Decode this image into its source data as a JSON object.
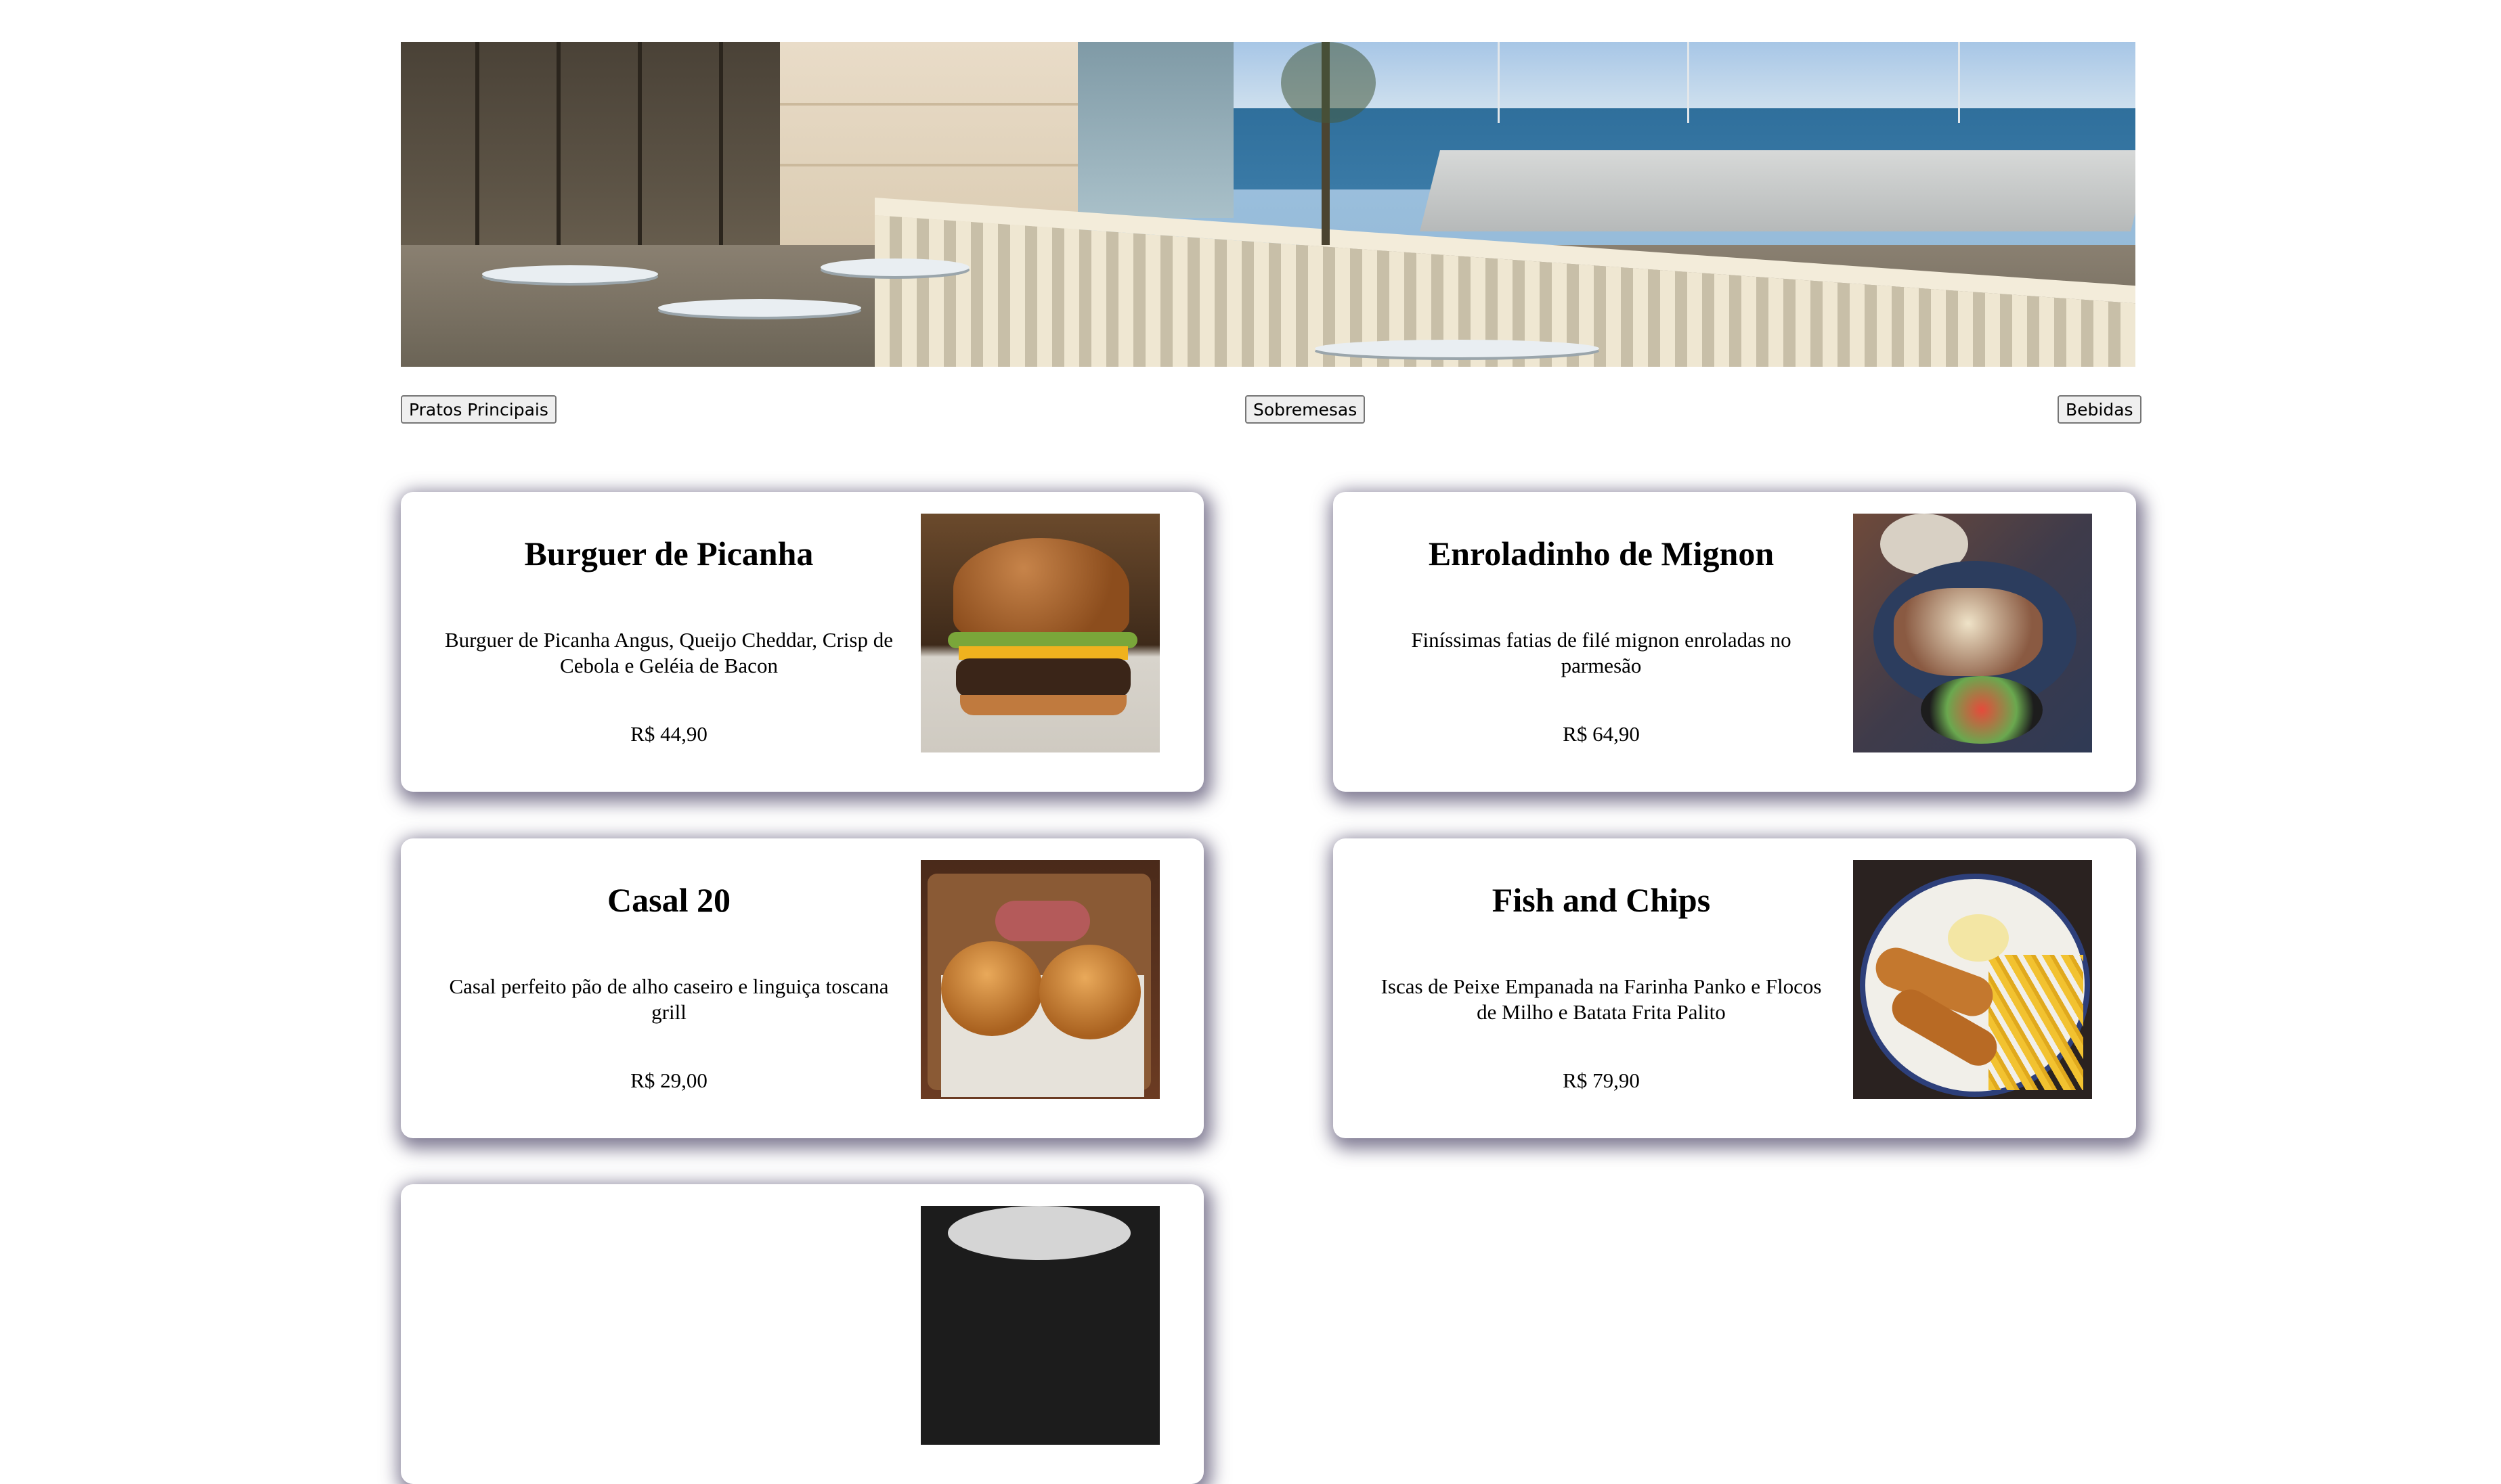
{
  "hero": {
    "image_alt": "Restaurant terrace overlooking the marina"
  },
  "tabs": [
    {
      "label": "Pratos Principais"
    },
    {
      "label": "Sobremesas"
    },
    {
      "label": "Bebidas"
    }
  ],
  "menu": [
    {
      "title": "Burguer de Picanha",
      "description": "Burguer de Picanha Angus, Queijo Cheddar, Crisp de Cebola e Geléia de Bacon",
      "price": "R$ 44,90",
      "photo": "burger-photo"
    },
    {
      "title": "Enroladinho de Mignon",
      "description": "Finíssimas fatias de filé mignon enroladas no parmesão",
      "price": "R$ 64,90",
      "photo": "mignon-photo"
    },
    {
      "title": "Casal 20",
      "description": "Casal perfeito pão de alho caseiro e linguiça toscana grill",
      "price": "R$ 29,00",
      "photo": "garlic-bread-photo"
    },
    {
      "title": "Fish and Chips",
      "description": "Iscas de Peixe Empanada na Farinha Panko e Flocos de Milho e Batata Frita Palito",
      "price": "R$ 79,90",
      "photo": "fish-and-chips-photo"
    }
  ],
  "colors": {
    "card_shadow": "#342c52",
    "button_bg": "#efefef",
    "button_border": "#767676"
  }
}
